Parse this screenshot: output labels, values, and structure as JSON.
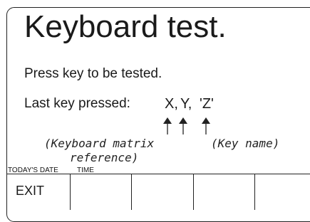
{
  "screen": {
    "title": "Keyboard test.",
    "prompt": "Press key to be tested.",
    "last_key_label": "Last key pressed:",
    "key_x": "X,",
    "key_y": "Y,",
    "key_name": "'Z'",
    "annotation_matrix_line1": "(Keyboard matrix",
    "annotation_matrix_line2": "reference)",
    "annotation_keyname": "(Key name)"
  },
  "status_bar": {
    "date_label": "TODAY'S DATE",
    "time_label": "TIME"
  },
  "softkeys": [
    "EXIT",
    "",
    "",
    "",
    ""
  ]
}
